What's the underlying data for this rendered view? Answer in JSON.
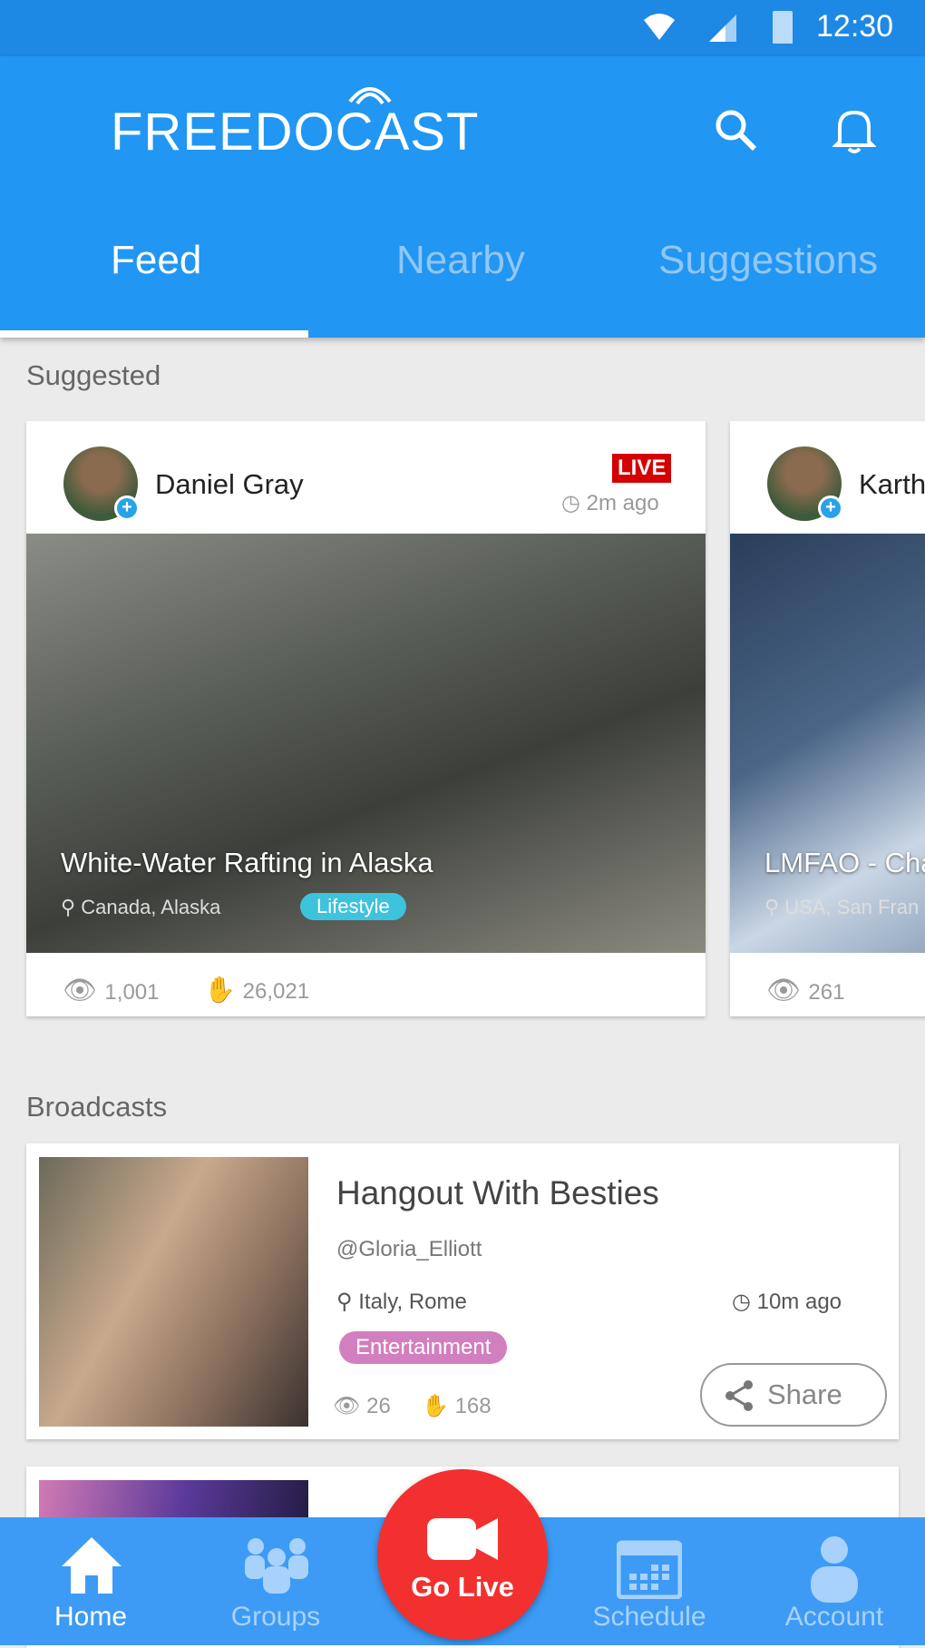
{
  "status_bar": {
    "time": "12:30"
  },
  "app": {
    "logo": "FREEDOCAST"
  },
  "tabs": [
    {
      "label": "Feed",
      "active": true
    },
    {
      "label": "Nearby"
    },
    {
      "label": "Suggestions"
    }
  ],
  "suggested": {
    "heading": "Suggested",
    "cards": [
      {
        "user": "Daniel Gray",
        "badge": "LIVE",
        "time": "2m ago",
        "title": "White-Water Rafting in Alaska",
        "location": "Canada, Alaska",
        "category": "Lifestyle",
        "views": "1,001",
        "claps": "26,021"
      },
      {
        "user": "Karth",
        "title": "LMFAO - Cha",
        "location": "USA, San Fran",
        "views": "261"
      }
    ]
  },
  "broadcasts": {
    "heading": "Broadcasts",
    "items": [
      {
        "title": "Hangout With Besties",
        "handle": "@Gloria_Elliott",
        "location": "Italy, Rome",
        "time": "10m ago",
        "category": "Entertainment",
        "views": "26",
        "claps": "168",
        "share": "Share"
      }
    ]
  },
  "nav": {
    "home": "Home",
    "groups": "Groups",
    "go_live": "Go Live",
    "schedule": "Schedule",
    "account": "Account"
  },
  "colors": {
    "primary": "#2196f3",
    "live": "#d50000",
    "lifestyle": "#3ec3dc",
    "entertainment": "#d17fbf",
    "go_live": "#f2302f"
  }
}
